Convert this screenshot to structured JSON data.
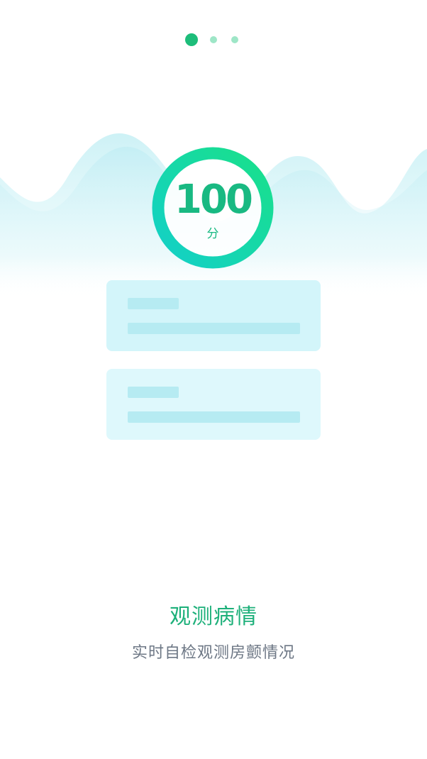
{
  "pager": {
    "total": 3,
    "active_index": 0
  },
  "score": {
    "value": "100",
    "unit": "分"
  },
  "onboarding": {
    "title": "观测病情",
    "subtitle": "实时自检观测房颤情况"
  },
  "colors": {
    "accent": "#1dbd7a",
    "dot_inactive": "#9ee6c7",
    "ring_start": "#13d0c8",
    "ring_end": "#19e08a",
    "card": "#d3f5fa",
    "skeleton_bar": "#b6ebf2",
    "subtitle": "#6d7785"
  },
  "icons": {
    "ring": "score-ring-icon",
    "waves": "wave-background"
  }
}
